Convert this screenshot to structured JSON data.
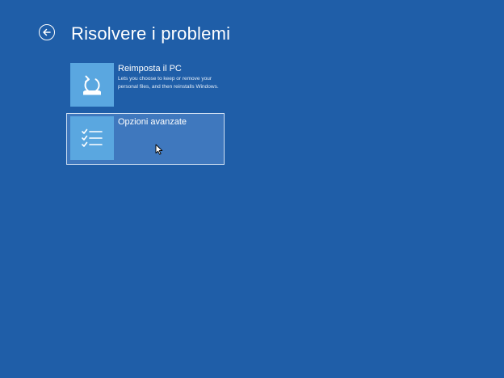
{
  "page": {
    "title": "Risolvere i problemi",
    "background_color": "#1f5ea8"
  },
  "back_button": {
    "icon": "arrow-left-circle-icon"
  },
  "options": [
    {
      "title": "Reimposta il PC",
      "description": "Lets you choose to keep or remove your personal files, and then reinstalls Windows.",
      "icon": "reset-pc-icon",
      "tile_color": "#5aa7e0",
      "selected": false
    },
    {
      "title": "Opzioni avanzate",
      "description": "",
      "icon": "checklist-icon",
      "tile_color": "#5aa7e0",
      "selected": true
    }
  ]
}
